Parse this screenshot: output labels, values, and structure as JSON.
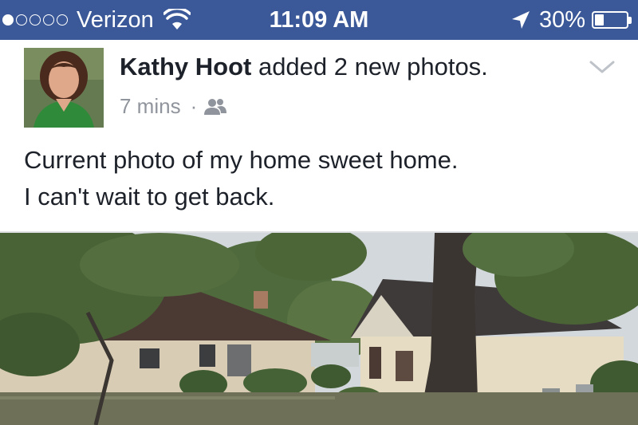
{
  "status_bar": {
    "signal_bars_filled": 1,
    "signal_bars_total": 5,
    "carrier": "Verizon",
    "time": "11:09 AM",
    "battery_percent": "30%",
    "battery_level": 0.3,
    "icons": [
      "wifi-icon",
      "location-arrow-icon",
      "battery-icon"
    ]
  },
  "post": {
    "author": "Kathy Hoot",
    "action": "added 2 new photos.",
    "timestamp": "7 mins",
    "separator": "·",
    "audience_icon": "friends-icon",
    "options_icon": "chevron-down-icon",
    "text_lines": [
      "Current photo of my home sweet home.",
      "I can't wait to get back."
    ]
  },
  "colors": {
    "status_bar_bg": "#3b5998",
    "text_primary": "#1d2129",
    "text_secondary": "#90949c"
  }
}
